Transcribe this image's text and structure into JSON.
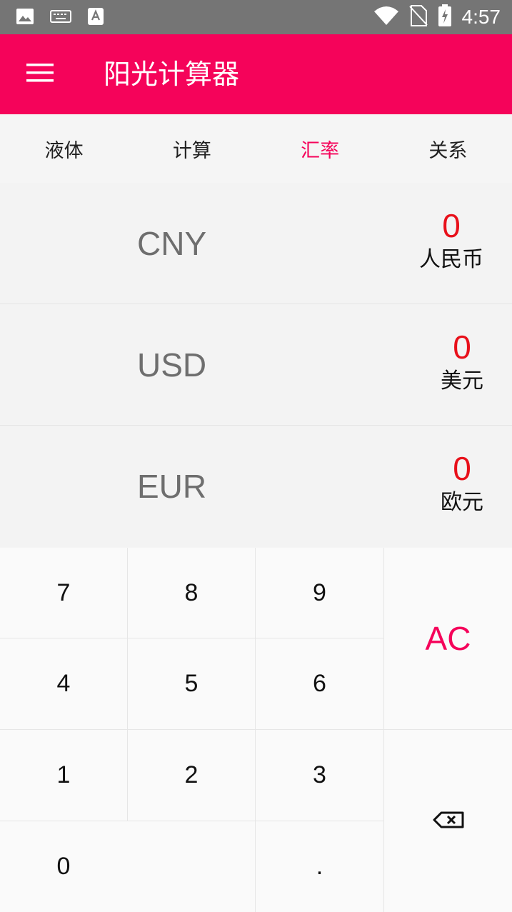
{
  "status_bar": {
    "time": "4:57",
    "icons": [
      "image-icon",
      "keyboard-icon",
      "font-icon",
      "wifi-icon",
      "no-sim-icon",
      "battery-charging-icon"
    ]
  },
  "app_bar": {
    "title": "阳光计算器",
    "menu_icon": "menu-icon",
    "color": "#f5035a"
  },
  "tabs": [
    {
      "label": "液体"
    },
    {
      "label": "计算"
    },
    {
      "label": "汇率"
    },
    {
      "label": "关系"
    }
  ],
  "active_tab": "汇率",
  "currencies": [
    {
      "code": "CNY",
      "value": "0",
      "name": "人民币"
    },
    {
      "code": "USD",
      "value": "0",
      "name": "美元"
    },
    {
      "code": "EUR",
      "value": "0",
      "name": "欧元"
    }
  ],
  "keypad": {
    "k7": "7",
    "k8": "8",
    "k9": "9",
    "k4": "4",
    "k5": "5",
    "k6": "6",
    "k1": "1",
    "k2": "2",
    "k3": "3",
    "k0": "0",
    "dot": ".",
    "ac": "AC",
    "backspace_icon": "backspace-icon"
  },
  "colors": {
    "accent": "#f5035a",
    "value": "#e8101a",
    "status_bar": "#757575"
  }
}
